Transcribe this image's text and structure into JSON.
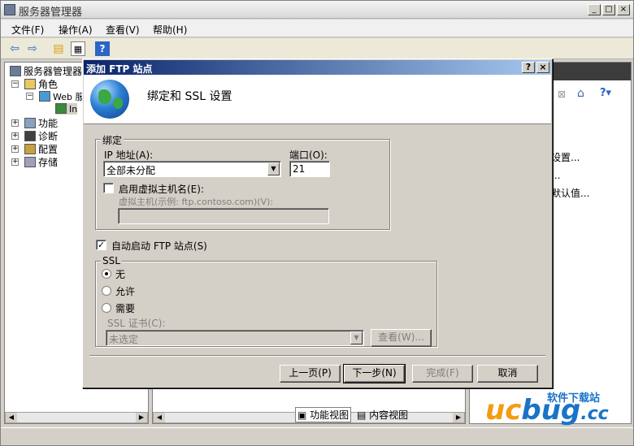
{
  "main_window": {
    "title": "服务器管理器",
    "controls": {
      "minimize": "_",
      "maximize": "□",
      "close": "×"
    }
  },
  "menu": [
    "文件(F)",
    "操作(A)",
    "查看(V)",
    "帮助(H)"
  ],
  "toolbar_icons": [
    "back-arrow-icon",
    "forward-arrow-icon",
    "up-folder-icon",
    "show-hide-tree-icon",
    "help-icon"
  ],
  "tree": {
    "root": "服务器管理器",
    "roles": "角色",
    "web": "Web 服",
    "iis": "In",
    "features": "功能",
    "diagnostics": "诊断",
    "config": "配置",
    "storage": "存储"
  },
  "right_pane": {
    "links": [
      "设置...",
      "...",
      "默认值..."
    ]
  },
  "view_tabs": {
    "feature_view": "功能视图",
    "content_view": "内容视图"
  },
  "watermark": {
    "logo_left": "uc",
    "logo_right": "bug",
    "logo_suffix": ".cc",
    "sub": "软件下载站"
  },
  "dialog": {
    "title": "添加 FTP 站点",
    "help_btn": "?",
    "close_btn": "×",
    "heading": "绑定和 SSL 设置",
    "binding": {
      "group_label": "绑定",
      "ip_label": "IP 地址(A):",
      "ip_value": "全部未分配",
      "port_label": "端口(O):",
      "port_value": "21",
      "vhost_enable_label": "启用虚拟主机名(E):",
      "vhost_enabled": false,
      "vhost_label": "虚拟主机(示例: ftp.contoso.com)(V):",
      "vhost_value": ""
    },
    "autostart": {
      "label": "自动启动 FTP 站点(S)",
      "checked": true
    },
    "ssl": {
      "group_label": "SSL",
      "options": [
        "无",
        "允许",
        "需要"
      ],
      "selected": "无",
      "cert_label": "SSL 证书(C):",
      "cert_value": "未选定",
      "view_btn": "查看(W)..."
    },
    "buttons": {
      "prev": "上一页(P)",
      "next": "下一步(N)",
      "finish": "完成(F)",
      "cancel": "取消"
    }
  }
}
